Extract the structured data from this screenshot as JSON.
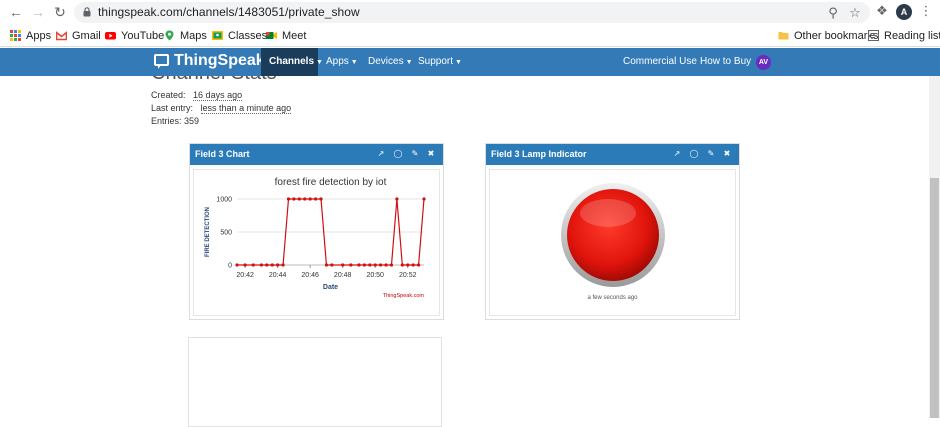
{
  "browser": {
    "url": "thingspeak.com/channels/1483051/private_show",
    "profile_initial": "A",
    "bookmarks": [
      {
        "label": "Apps",
        "color": "#4285f4"
      },
      {
        "label": "Gmail",
        "color": "#ea4335"
      },
      {
        "label": "YouTube",
        "color": "#ff0000"
      },
      {
        "label": "Maps",
        "color": "#34a853"
      },
      {
        "label": "Classes",
        "color": "#fbbc04"
      },
      {
        "label": "Meet",
        "color": "#00832d"
      }
    ],
    "other_bookmarks": "Other bookmarks",
    "reading_list": "Reading list"
  },
  "nav": {
    "brand": "ThingSpeak",
    "brand_mark": "™",
    "items": [
      "Channels",
      "Apps",
      "Devices",
      "Support"
    ],
    "active": "Channels",
    "commercial": "Commercial Use",
    "buy": "How to Buy",
    "avatar": "AV",
    "color": "#337ab7"
  },
  "page": {
    "heading": "Channel Stats",
    "created_label": "Created:",
    "created_value": "16 days ago",
    "last_entry_label": "Last entry:",
    "last_entry_value": "less than a minute ago",
    "entries_label": "Entries:",
    "entries_value": "359"
  },
  "widgets": {
    "chart_title": "Field 3 Chart",
    "lamp_title": "Field 3 Lamp Indicator",
    "lamp_caption": "a few seconds ago",
    "lamp_color": "#e0140c",
    "credit": "ThingSpeak.com"
  },
  "chart_data": {
    "type": "line",
    "title": "forest fire detection by iot",
    "xlabel": "Date",
    "ylabel": "FIRE DETECTION",
    "ylim": [
      0,
      1000
    ],
    "yticks": [
      0,
      500,
      1000
    ],
    "xticks": [
      "20:42",
      "20:44",
      "20:46",
      "20:48",
      "20:50",
      "20:52"
    ],
    "xrange": [
      "20:41:30",
      "20:53:00"
    ],
    "color": "#d01010",
    "series": [
      {
        "x": [
          "20:41:30",
          "20:42:00",
          "20:42:30",
          "20:43:00",
          "20:43:20",
          "20:43:40",
          "20:44:00",
          "20:44:20",
          "20:44:40",
          "20:45:00",
          "20:45:20",
          "20:45:40",
          "20:46:00",
          "20:46:20",
          "20:46:40",
          "20:47:00",
          "20:47:20",
          "20:48:00",
          "20:48:30",
          "20:49:00",
          "20:49:20",
          "20:49:40",
          "20:50:00",
          "20:50:20",
          "20:50:40",
          "20:51:00",
          "20:51:20",
          "20:51:40",
          "20:52:00",
          "20:52:20",
          "20:52:40",
          "20:53:00"
        ],
        "values": [
          0,
          0,
          0,
          0,
          0,
          0,
          0,
          0,
          1000,
          1000,
          1000,
          1000,
          1000,
          1000,
          1000,
          0,
          0,
          0,
          0,
          0,
          0,
          0,
          0,
          0,
          0,
          0,
          1000,
          0,
          0,
          0,
          0,
          1000
        ]
      }
    ]
  }
}
